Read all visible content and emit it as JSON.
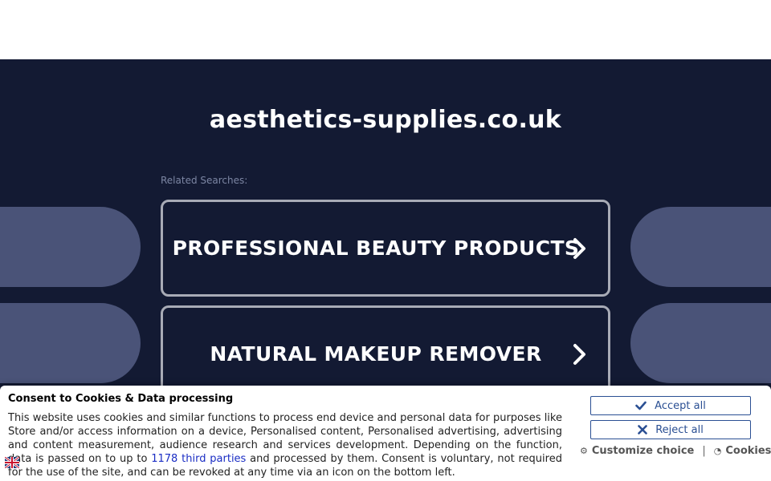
{
  "site": {
    "title": "aesthetics-supplies.co.uk"
  },
  "related": {
    "label": "Related Searches:",
    "items": [
      {
        "label": "PROFESSIONAL BEAUTY PRODUCTS"
      },
      {
        "label": "NATURAL MAKEUP REMOVER"
      }
    ]
  },
  "consent": {
    "title": "Consent to Cookies & Data processing",
    "text_before_link": "This website uses cookies and similar functions to process end device and personal data for purposes like Store and/or access information on a device, Personalised content, Personalised advertising, advertising and content measurement, audience research and services development. Depending on the function, data is passed on to up to ",
    "link_text": "1178 third parties",
    "text_after_link": " and processed by them. Consent is voluntary, not required for the use of the site, and can be revoked at any time via an icon on the bottom left.",
    "accept_label": "Accept all",
    "reject_label": "Reject all",
    "customize_label": "Customize choice",
    "separator": "|",
    "cookies_label": "Cookies"
  },
  "icons": {
    "chevron": "chevron-right-icon",
    "accept": "check-icon",
    "reject": "x-icon",
    "customize": "gear-icon",
    "cookies": "cookie-icon",
    "flag": "uk-flag-icon"
  },
  "colors": {
    "background": "#131a33",
    "decor": "#4a5378",
    "button_border": "#a8abb6",
    "consent_button": "#2a4f93",
    "link": "#1a2dc4"
  }
}
